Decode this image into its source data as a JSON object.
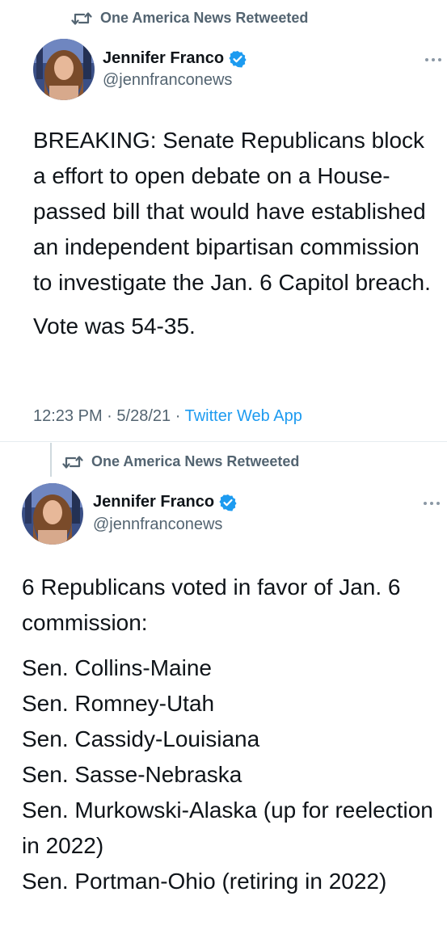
{
  "tweet1": {
    "retweet_label": "One America News Retweeted",
    "author_name": "Jennifer Franco",
    "author_handle": "@jennfranconews",
    "paragraphs": [
      "BREAKING: Senate Republicans block a effort to open debate on a House-passed bill that would have established an independent bipartisan commission to investigate the Jan. 6 Capitol breach.",
      "Vote was 54-35."
    ],
    "time": "12:23 PM",
    "date": "5/28/21",
    "separator": "·",
    "source": "Twitter Web App"
  },
  "tweet2": {
    "retweet_label": "One America News Retweeted",
    "author_name": "Jennifer Franco",
    "author_handle": "@jennfranconews",
    "paragraphs": [
      "6 Republicans voted in favor of Jan. 6 commission:"
    ],
    "list": [
      "Sen. Collins-Maine",
      "Sen. Romney-Utah",
      "Sen. Cassidy-Louisiana",
      "Sen. Sasse-Nebraska",
      "Sen. Murkowski-Alaska (up for reelection in 2022)",
      "Sen. Portman-Ohio (retiring in 2022)"
    ]
  },
  "colors": {
    "text": "#0f1419",
    "secondary": "#536471",
    "link": "#1d9bf0",
    "verified": "#1d9bf0"
  },
  "icons": [
    "retweet-icon",
    "verified-badge-icon",
    "more-options-icon",
    "avatar"
  ]
}
